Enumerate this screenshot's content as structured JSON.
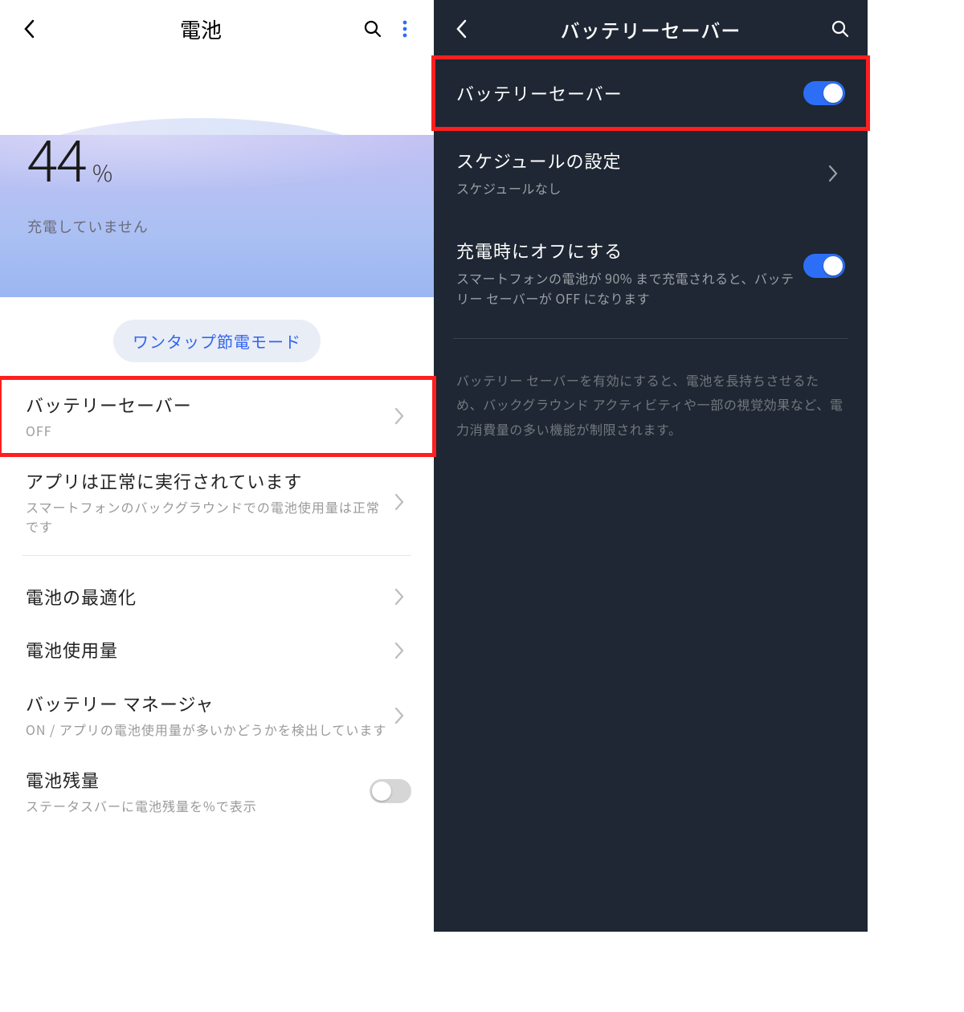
{
  "left": {
    "header": {
      "title": "電池"
    },
    "battery": {
      "percent": "44",
      "unit": "%",
      "status": "充電していません"
    },
    "pill": "ワンタップ節電モード",
    "items": {
      "saver": {
        "title": "バッテリーセーバー",
        "sub": "OFF"
      },
      "apps": {
        "title": "アプリは正常に実行されています",
        "sub": "スマートフォンのバックグラウンドでの電池使用量は正常です"
      },
      "opt": {
        "title": "電池の最適化"
      },
      "usage": {
        "title": "電池使用量"
      },
      "manager": {
        "title": "バッテリー マネージャ",
        "sub": "ON / アプリの電池使用量が多いかどうかを検出しています"
      },
      "remain": {
        "title": "電池残量",
        "sub": "ステータスバーに電池残量を%で表示"
      }
    }
  },
  "right": {
    "header": {
      "title": "バッテリーセーバー"
    },
    "items": {
      "saver": {
        "title": "バッテリーセーバー"
      },
      "schedule": {
        "title": "スケジュールの設定",
        "sub": "スケジュールなし"
      },
      "chargeoff": {
        "title": "充電時にオフにする",
        "sub": "スマートフォンの電池が 90% まで充電されると、バッテリー セーバーが OFF になります"
      }
    },
    "desc": "バッテリー セーバーを有効にすると、電池を長持ちさせるため、バックグラウンド アクティビティや一部の視覚効果など、電力消費量の多い機能が制限されます。"
  }
}
